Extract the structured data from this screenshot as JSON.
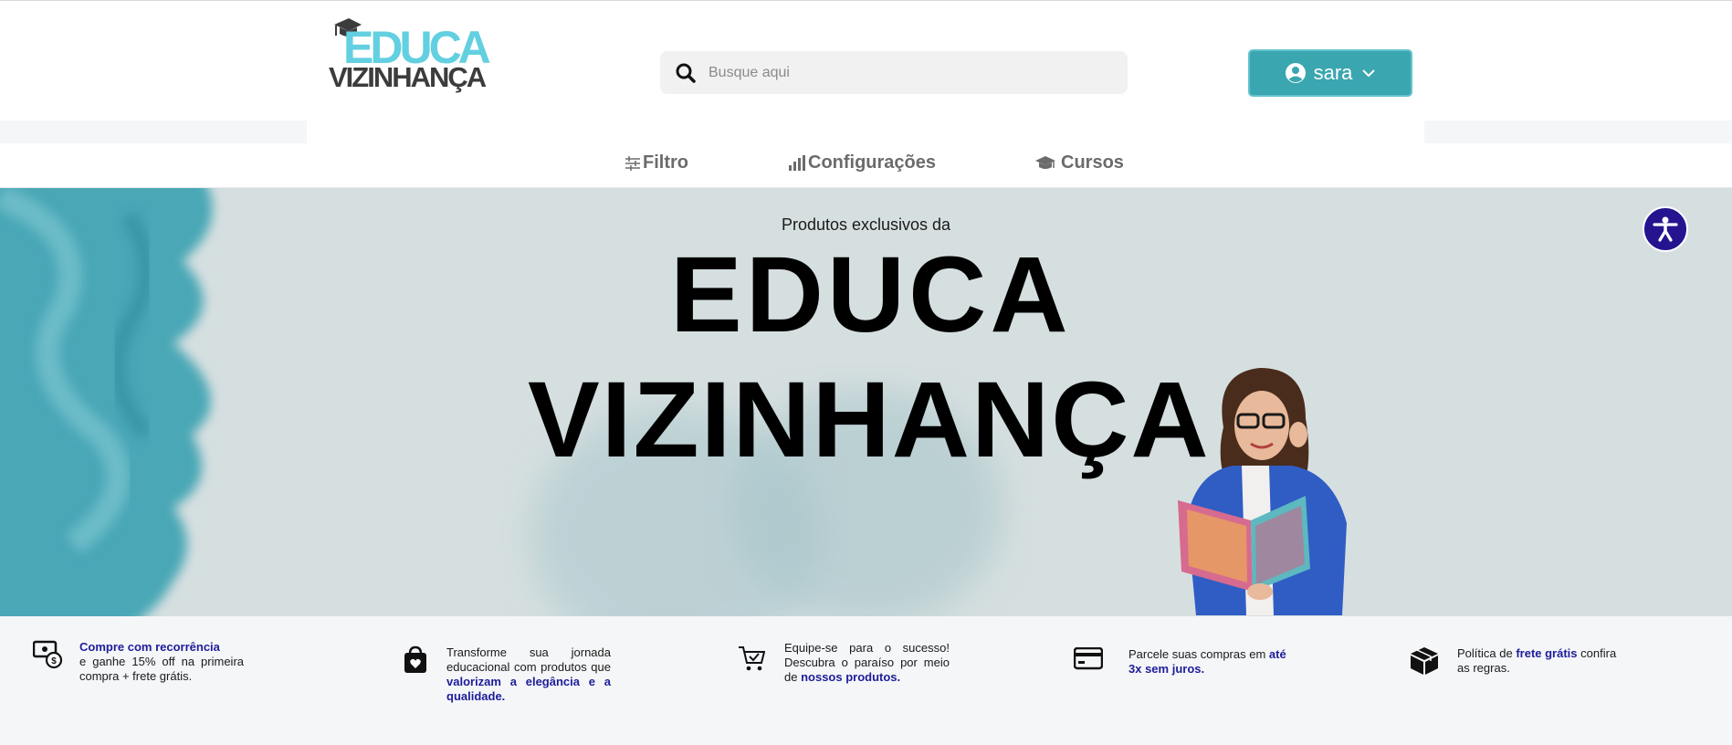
{
  "header": {
    "logo": {
      "line1": "EDUCA",
      "line2": "VIZINHANÇA"
    },
    "search": {
      "placeholder": "Busque aqui"
    },
    "user": {
      "name": "sara"
    }
  },
  "nav": {
    "items": [
      {
        "label": "Filtro",
        "icon": "sliders-icon"
      },
      {
        "label": "Configurações",
        "icon": "bar-chart-icon"
      },
      {
        "label": "Cursos",
        "icon": "graduation-cap-icon"
      }
    ]
  },
  "hero": {
    "pre_title": "Produtos exclusivos da",
    "title_line1": "EDUCA",
    "title_line2": "VIZINHANÇA"
  },
  "features": [
    {
      "icon": "money-icon",
      "highlight": "Compre com recorrência",
      "text": "e ganhe 15% off na primeira compra + frete grátis."
    },
    {
      "icon": "shopping-bag-heart-icon",
      "text": "Transforme sua jornada educacional com produtos que",
      "highlight": "valorizam a elegância e a qualidade."
    },
    {
      "icon": "cart-check-icon",
      "text": "Equipe-se para o sucesso! Descubra o paraíso por meio de",
      "highlight": "nossos produtos."
    },
    {
      "icon": "credit-card-icon",
      "text": "Parcele suas compras em",
      "highlight": "até 3x sem juros."
    },
    {
      "icon": "box-icon",
      "text_before": "Política de",
      "highlight": "frete grátis",
      "text_after": "confira as regras."
    }
  ],
  "colors": {
    "accent": "#3aa6b0",
    "logo_cyan": "#62d0e0",
    "highlight": "#1d1d9a",
    "accessibility": "#24148f"
  }
}
